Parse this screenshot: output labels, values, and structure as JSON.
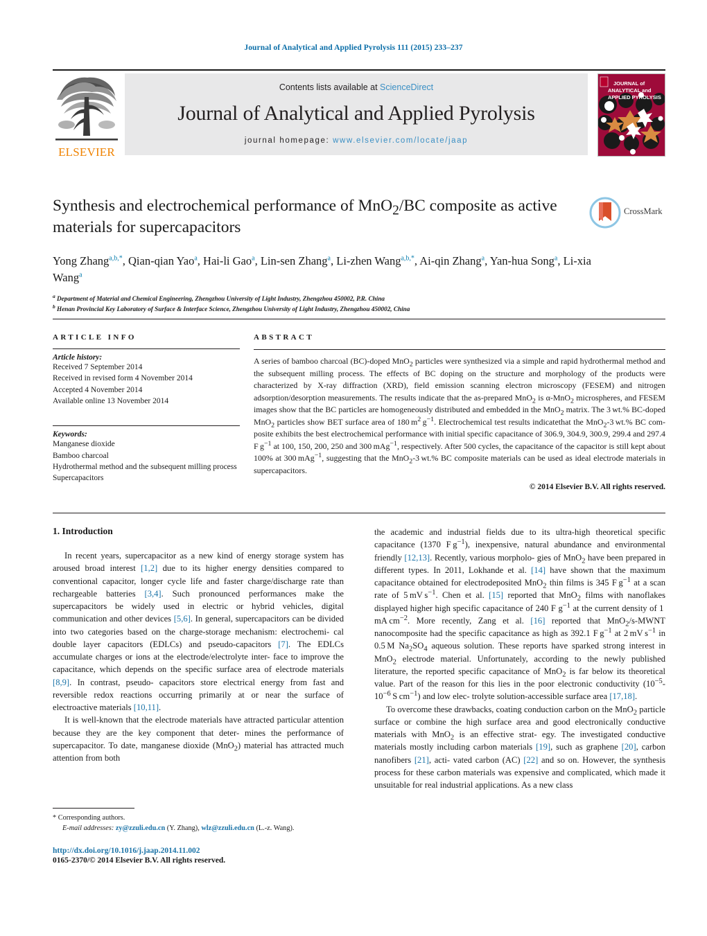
{
  "running_head": "Journal of Analytical and Applied Pyrolysis 111 (2015) 233–237",
  "masthead": {
    "publisher_name": "ELSEVIER",
    "contents_prefix": "Contents lists available at ",
    "contents_link": "ScienceDirect",
    "journal_title": "Journal of Analytical and Applied Pyrolysis",
    "homepage_prefix": "journal homepage: ",
    "homepage_url": "www.elsevier.com/locate/jaap",
    "cover_line1": "JOURNAL of",
    "cover_line2": "ANALYTICAL and",
    "cover_line3": "APPLIED PYROLYSIS"
  },
  "article": {
    "title": "Synthesis and electrochemical performance of MnO2/BC composite as active materials for supercapacitors",
    "crossmark_label": "CrossMark",
    "authors_html": "Yong Zhang<sup>a,b,</sup><sup>*</sup>, Qian-qian Yao<sup>a</sup>, Hai-li Gao<sup>a</sup>, Lin-sen Zhang<sup>a</sup>, Li-zhen Wang<sup>a,b,</sup><sup>*</sup>, Ai-qin Zhang<sup>a</sup>, Yan-hua Song<sup>a</sup>, Li-xia Wang<sup>a</sup>",
    "affiliation_a": "Department of Material and Chemical Engineering, Zhengzhou University of Light Industry, Zhengzhou 450002, P.R. China",
    "affiliation_b": "Henan Provincial Key Laboratory of Surface & Interface Science, Zhengzhou University of Light Industry, Zhengzhou 450002, China"
  },
  "article_info": {
    "heading": "ARTICLE INFO",
    "history_label": "Article history:",
    "history": [
      "Received 7 September 2014",
      "Received in revised form 4 November 2014",
      "Accepted 4 November 2014",
      "Available online 13 November 2014"
    ],
    "keywords_label": "Keywords:",
    "keywords": [
      "Manganese dioxide",
      "Bamboo charcoal",
      "Hydrothermal method and the subsequent milling process",
      "Supercapacitors"
    ]
  },
  "abstract": {
    "heading": "ABSTRACT",
    "copyright": "© 2014 Elsevier B.V. All rights reserved."
  },
  "sections": {
    "intro_heading": "1.  Introduction"
  },
  "footnote": {
    "corresponding": "*  Corresponding authors.",
    "email_label": "E-mail addresses:",
    "email1": "zy@zzuli.edu.cn",
    "email1_who": "(Y. Zhang),",
    "email2": "wlz@zzuli.edu.cn",
    "email2_who": "(L.-z. Wang)."
  },
  "doi": {
    "url": "http://dx.doi.org/10.1016/j.jaap.2014.11.002",
    "issn_line": "0165-2370/© 2014 Elsevier B.V. All rights reserved."
  },
  "colors": {
    "link_blue": "#1c74a8",
    "header_blue": "#0b6ea8",
    "elsevier_orange": "#ef8200",
    "band_gray": "#e8e8e9",
    "cover_red": "#9e0b3a"
  }
}
